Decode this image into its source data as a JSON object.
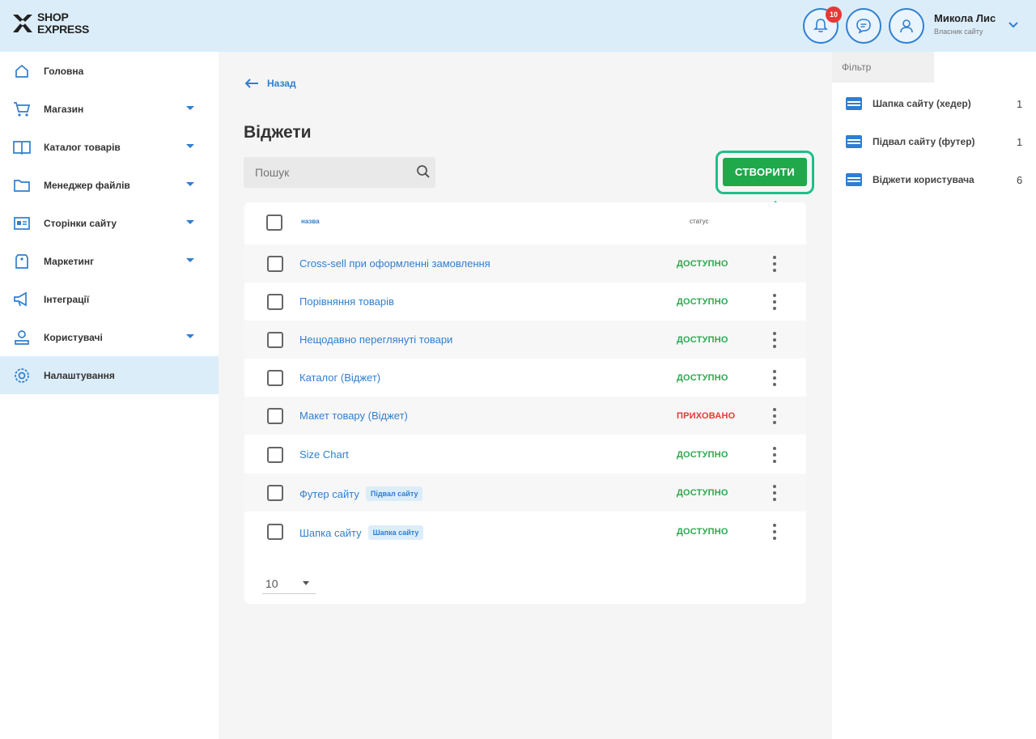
{
  "brand": {
    "line1": "SHOP",
    "line2": "EXPRESS"
  },
  "header": {
    "notifications_count": "10",
    "user_name": "Микола Лис",
    "user_role": "Власник сайту"
  },
  "sidebar": {
    "items": [
      {
        "label": "Головна",
        "icon": "home-icon",
        "has_submenu": false
      },
      {
        "label": "Магазин",
        "icon": "cart-icon",
        "has_submenu": true
      },
      {
        "label": "Каталог товарів",
        "icon": "book-icon",
        "has_submenu": true
      },
      {
        "label": "Менеджер файлів",
        "icon": "folder-icon",
        "has_submenu": true
      },
      {
        "label": "Сторінки сайту",
        "icon": "pages-icon",
        "has_submenu": true
      },
      {
        "label": "Маркетинг",
        "icon": "tag-icon",
        "has_submenu": true
      },
      {
        "label": "Інтеграції",
        "icon": "megaphone-icon",
        "has_submenu": false
      },
      {
        "label": "Користувачі",
        "icon": "users-icon",
        "has_submenu": true
      },
      {
        "label": "Налаштування",
        "icon": "gear-icon",
        "has_submenu": false,
        "active": true
      }
    ]
  },
  "main": {
    "back_label": "Назад",
    "title": "Віджети",
    "search_placeholder": "Пошук",
    "create_label": "СТВОРИТИ",
    "table": {
      "col_name": "назва",
      "col_status": "статус",
      "rows": [
        {
          "name": "Cross-sell при оформленні замовлення",
          "tag": "",
          "status": "ДОСТУПНО",
          "status_kind": "ok"
        },
        {
          "name": "Порівняння товарів",
          "tag": "",
          "status": "ДОСТУПНО",
          "status_kind": "ok"
        },
        {
          "name": "Нещодавно переглянуті товари",
          "tag": "",
          "status": "ДОСТУПНО",
          "status_kind": "ok"
        },
        {
          "name": "Каталог (Віджет)",
          "tag": "",
          "status": "ДОСТУПНО",
          "status_kind": "ok"
        },
        {
          "name": "Макет товару (Віджет)",
          "tag": "",
          "status": "ПРИХОВАНО",
          "status_kind": "hidden"
        },
        {
          "name": "Size Chart",
          "tag": "",
          "status": "ДОСТУПНО",
          "status_kind": "ok"
        },
        {
          "name": "Футер сайту",
          "tag": "Підвал сайту",
          "status": "ДОСТУПНО",
          "status_kind": "ok"
        },
        {
          "name": "Шапка сайту",
          "tag": "Шапка сайту",
          "status": "ДОСТУПНО",
          "status_kind": "ok"
        }
      ],
      "page_size": "10"
    }
  },
  "filter_panel": {
    "tab_label": "Фільтр",
    "items": [
      {
        "label": "Шапка сайту (хедер)",
        "count": "1"
      },
      {
        "label": "Підвал сайту (футер)",
        "count": "1"
      },
      {
        "label": "Віджети користувача",
        "count": "6"
      }
    ]
  },
  "colors": {
    "accent": "#2f7fd0",
    "header_bg": "#dcedfa",
    "create_button": "#1fa94b",
    "highlight": "#1fbf88",
    "status_ok": "#2ea84f",
    "status_hidden": "#e53935"
  }
}
